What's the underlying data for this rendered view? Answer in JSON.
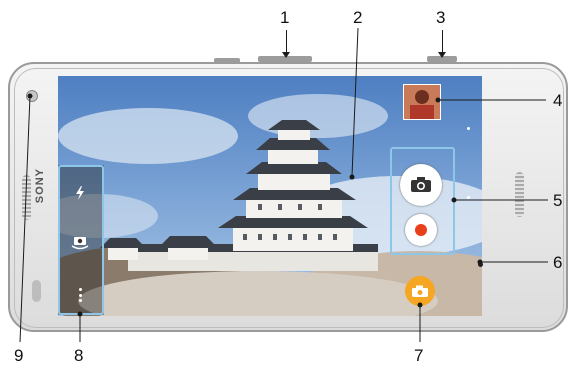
{
  "device": {
    "brand": "SONY"
  },
  "callouts": [
    "1",
    "2",
    "3",
    "4",
    "5",
    "6",
    "7",
    "8",
    "9"
  ],
  "colors": {
    "highlight": "#8ec6ea",
    "capture_orange": "#f5a623",
    "record_red": "#e8411a"
  },
  "icons": {
    "flash": "flash-icon",
    "camera_switch": "camera-switch-icon",
    "menu": "menu-dots-icon",
    "still_capture": "camera-icon",
    "video_record": "record-icon",
    "mode_select": "camera-mode-icon",
    "thumbnail": "photo-thumbnail"
  }
}
